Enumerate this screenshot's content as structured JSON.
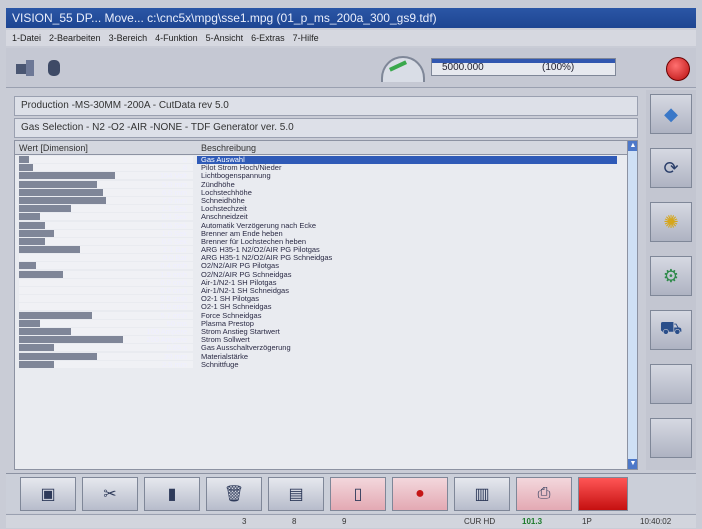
{
  "window": {
    "title": "VISION_55 DP... Move... c:\\cnc5x\\mpg\\sse1.mpg  (01_p_ms_200a_300_gs9.tdf)"
  },
  "menu": [
    "1-Datei",
    "2-Bearbeiten",
    "3-Bereich",
    "4-Funktion",
    "5-Ansicht",
    "6-Extras",
    "7-Hilfe"
  ],
  "toolbar": {
    "progress_value": "5000.000",
    "progress_percent": "(100%)"
  },
  "info": {
    "production": "Production -MS-30MM -200A - CutData rev 5.0",
    "gas_selection": "Gas Selection - N2 -O2 -AIR -NONE - TDF Generator ver. 5.0"
  },
  "table": {
    "headers": [
      "Wert [Dimension]",
      "Beschreibung"
    ],
    "rows": [
      {
        "value": "5",
        "bar": 0.06,
        "desc": "Gas Auswahl",
        "selected": true
      },
      {
        "value": "8",
        "bar": 0.08,
        "desc": "Pilot Strom Hoch/Nieder"
      },
      {
        "value": "154 Volt",
        "bar": 0.55,
        "desc": "Lichtbogenspannung"
      },
      {
        "value": "5.0 mm",
        "bar": 0.45,
        "desc": "Zündhöhe"
      },
      {
        "value": "6.0 mm",
        "bar": 0.48,
        "desc": "Lochstechhöhe"
      },
      {
        "value": "7.0 mm",
        "bar": 0.5,
        "desc": "Schneidhöhe"
      },
      {
        "value": "1.1 Sek",
        "bar": 0.3,
        "desc": "Lochstechzeit"
      },
      {
        "value": "0.1 Sek",
        "bar": 0.12,
        "desc": "Anschneidzeit"
      },
      {
        "value": "0.5 Sek",
        "bar": 0.15,
        "desc": "Automatik Verzögerung nach Ecke"
      },
      {
        "value": "1.0 Sek",
        "bar": 0.2,
        "desc": "Brenner am Ende heben"
      },
      {
        "value": "0.5 Sek",
        "bar": 0.15,
        "desc": "Brenner für Lochstechen heben"
      },
      {
        "value": "2.1 Bar",
        "bar": 0.35,
        "desc": "ARG H35-1 N2/O2/AIR PG Pilotgas"
      },
      {
        "value": "0.0 Bar",
        "bar": 0.0,
        "desc": "ARG H35-1 N2/O2/AIR PG Schneidgas"
      },
      {
        "value": "0.4 cmh",
        "bar": 0.1,
        "desc": "O2/N2/AIR PG Pilotgas"
      },
      {
        "value": "1.9 cmh",
        "bar": 0.25,
        "desc": "O2/N2/AIR PG Schneidgas"
      },
      {
        "value": "0.0 cmh",
        "bar": 0.0,
        "desc": "Air-1/N2-1 SH Pilotgas"
      },
      {
        "value": "0.0 cmh",
        "bar": 0.0,
        "desc": "Air-1/N2-1 SH Schneidgas"
      },
      {
        "value": "0.0 cmh",
        "bar": 0.0,
        "desc": "O2-1 SH Pilotgas"
      },
      {
        "value": "0.0 cmh",
        "bar": 0.0,
        "desc": "O2-1 SH Schneidgas"
      },
      {
        "value": "5.7 cmh",
        "bar": 0.42,
        "desc": "Force Schneidgas"
      },
      {
        "value": "50 ms",
        "bar": 0.12,
        "desc": "Plasma Prestop"
      },
      {
        "value": "100 Ampere",
        "bar": 0.3,
        "desc": "Strom Anstieg Startwert"
      },
      {
        "value": "200 Ampere",
        "bar": 0.6,
        "desc": "Strom Sollwert"
      },
      {
        "value": "0.65 s",
        "bar": 0.2,
        "desc": "Gas Ausschaltverzögerung"
      },
      {
        "value": "30 mm",
        "bar": 0.45,
        "desc": "Materialstärke"
      },
      {
        "value": "2.5 mm",
        "bar": 0.2,
        "desc": "Schnittfuge"
      }
    ]
  },
  "side_buttons": [
    "navigate-icon",
    "conveyor-icon",
    "sparkle-icon",
    "machine-icon",
    "cart-icon",
    "blank-button",
    "blank-button-2"
  ],
  "bottom_buttons": [
    {
      "name": "folder-icon",
      "pink": false
    },
    {
      "name": "tools-icon",
      "pink": false
    },
    {
      "name": "trash-icon",
      "pink": false
    },
    {
      "name": "delete-icon",
      "pink": false
    },
    {
      "name": "document-icon",
      "pink": false
    },
    {
      "name": "page-icon",
      "pink": true
    },
    {
      "name": "record-icon",
      "pink": true
    },
    {
      "name": "book-icon",
      "pink": false
    },
    {
      "name": "print-icon",
      "pink": true
    },
    {
      "name": "close-red",
      "pink": true
    }
  ],
  "status": {
    "s1": "3",
    "s2": "8",
    "s3": "9",
    "mode": "CUR HD",
    "value": "101.3",
    "misc": "1P",
    "time": "10:40:02"
  },
  "colors": {
    "titlebar": "#2b56a6",
    "selection": "#2f5ab7",
    "stop_button": "#c81616"
  }
}
